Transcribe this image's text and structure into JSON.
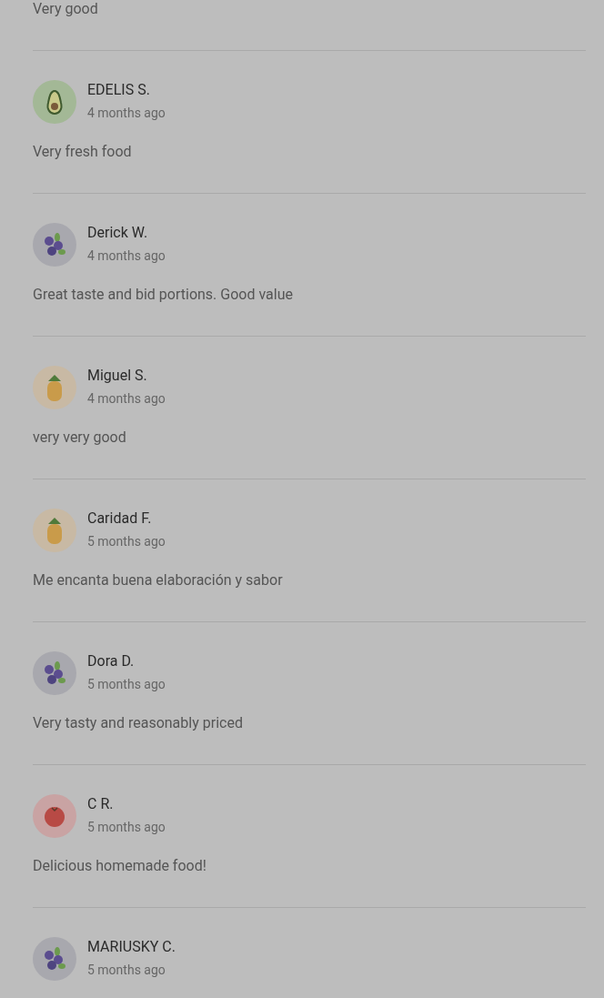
{
  "previous_review_comment": "Very good",
  "reviews": [
    {
      "name": "EDELIS S.",
      "time": "4 months ago",
      "avatar": {
        "kind": "avocado"
      },
      "comment": "Very fresh food"
    },
    {
      "name": "Derick W.",
      "time": "4 months ago",
      "avatar": {
        "kind": "blueberry"
      },
      "comment": "Great taste and bid portions. Good value"
    },
    {
      "name": "Miguel S.",
      "time": "4 months ago",
      "avatar": {
        "kind": "pineapple"
      },
      "comment": "very very good"
    },
    {
      "name": "Caridad F.",
      "time": "5 months ago",
      "avatar": {
        "kind": "pineapple"
      },
      "comment": "Me encanta buena elaboración y sabor"
    },
    {
      "name": "Dora D.",
      "time": "5 months ago",
      "avatar": {
        "kind": "blueberry"
      },
      "comment": "Very tasty and reasonably priced"
    },
    {
      "name": "C R.",
      "time": "5 months ago",
      "avatar": {
        "kind": "tomato"
      },
      "comment": "Delicious homemade food!"
    },
    {
      "name": "MARIUSKY C.",
      "time": "5 months ago",
      "avatar": {
        "kind": "blueberry"
      }
    }
  ]
}
